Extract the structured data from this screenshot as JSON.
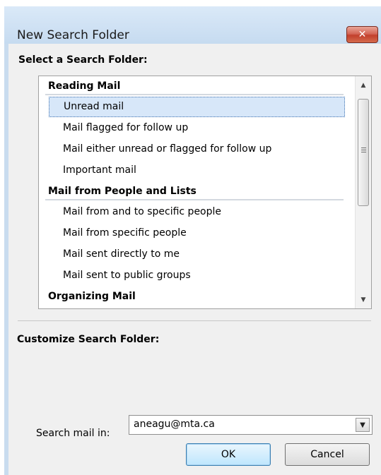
{
  "dialog": {
    "title": "New Search Folder",
    "close_glyph": "✕"
  },
  "select_section": {
    "label": "Select a Search Folder:",
    "groups": [
      {
        "header": "Reading Mail",
        "items": [
          "Unread mail",
          "Mail flagged for follow up",
          "Mail either unread or flagged for follow up",
          "Important mail"
        ]
      },
      {
        "header": "Mail from People and Lists",
        "items": [
          "Mail from and to specific people",
          "Mail from specific people",
          "Mail sent directly to me",
          "Mail sent to public groups"
        ]
      },
      {
        "header": "Organizing Mail",
        "items": []
      }
    ],
    "selected_item": "Unread mail"
  },
  "customize_section": {
    "label": "Customize Search Folder:"
  },
  "search_in": {
    "label": "Search mail in:",
    "value": "aneagu@mta.ca"
  },
  "buttons": {
    "ok": "OK",
    "cancel": "Cancel"
  },
  "icons": {
    "close": "close-icon",
    "scroll_up": "chevron-up-icon",
    "scroll_down": "chevron-down-icon",
    "combo": "chevron-down-icon"
  }
}
